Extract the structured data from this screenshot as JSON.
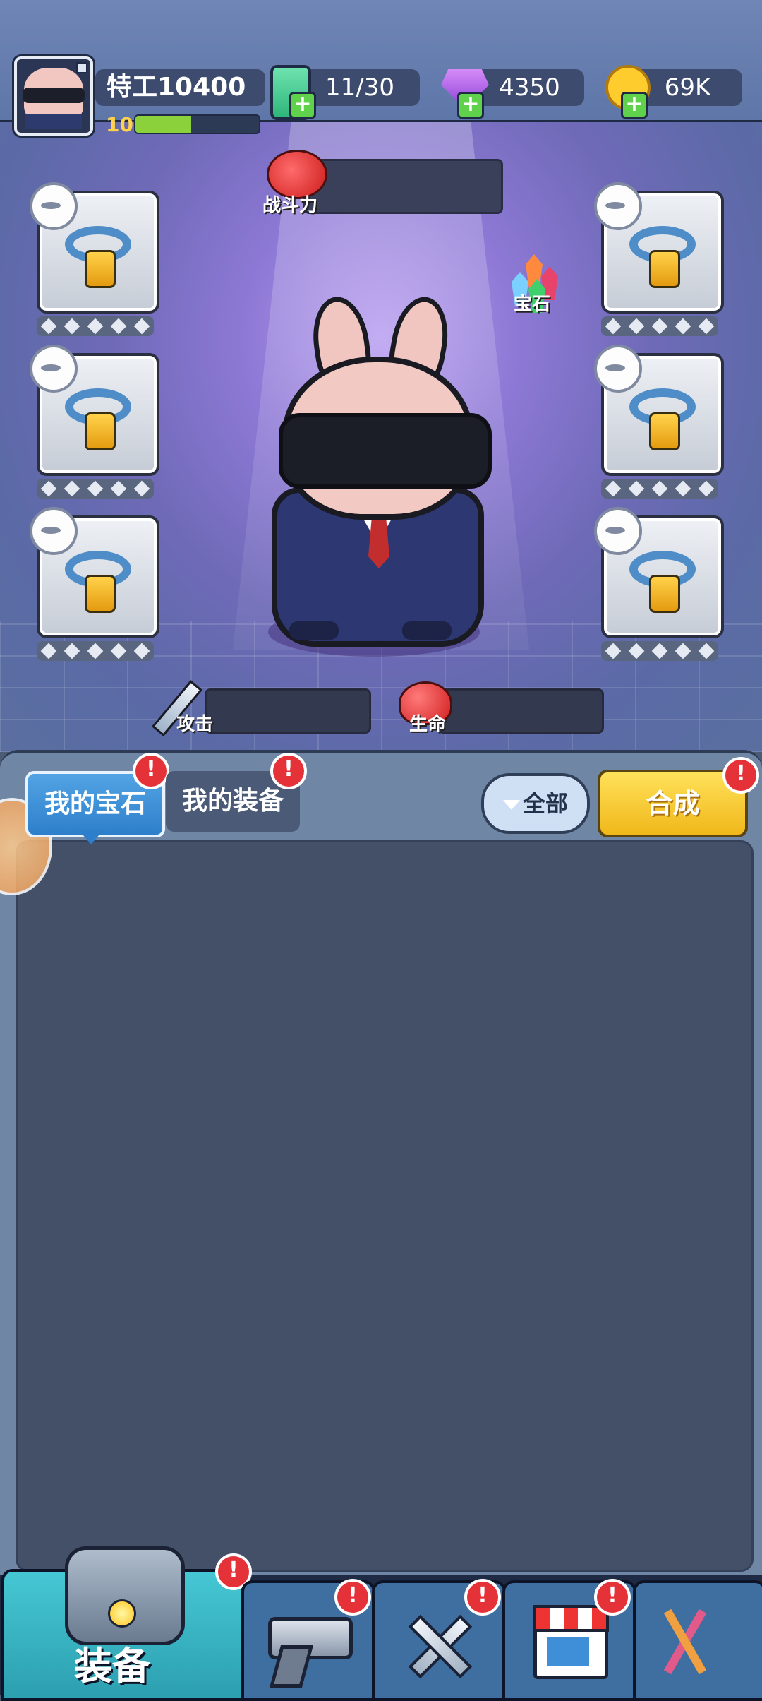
{
  "header": {
    "player_name": "特工10400",
    "level": "10",
    "xp_fraction": 0.45,
    "energy": "11/30",
    "gems": "4350",
    "coins": "69K"
  },
  "hero": {
    "power_label": "战斗力",
    "gem_button_label": "宝石",
    "attack_label": "攻击",
    "life_label": "生命"
  },
  "slots_left": [
    {
      "stars": 5
    },
    {
      "stars": 5
    },
    {
      "stars": 5
    }
  ],
  "slots_right": [
    {
      "stars": 5
    },
    {
      "stars": 5
    },
    {
      "stars": 5
    }
  ],
  "panel": {
    "tab_my_gems": "我的宝石",
    "tab_my_equipment": "我的装备",
    "filter_label": "全部",
    "merge_label": "合成"
  },
  "badges": {
    "alert": "!"
  },
  "nav": {
    "equipment_label": "装备"
  },
  "colors": {
    "accent_blue": "#2d7fcb",
    "merge_yellow": "#f0b81a",
    "badge_red": "#e53138",
    "xp_green": "#8ad13c"
  },
  "icons": [
    "battery-icon",
    "gem-icon",
    "coin-icon",
    "power-fist-icon",
    "gem-cluster-icon",
    "ring-icon",
    "hat-icon",
    "sword-icon",
    "heart-icon",
    "chest-icon",
    "gun-icon",
    "crossed-swords-icon",
    "shop-icon",
    "dna-icon"
  ]
}
